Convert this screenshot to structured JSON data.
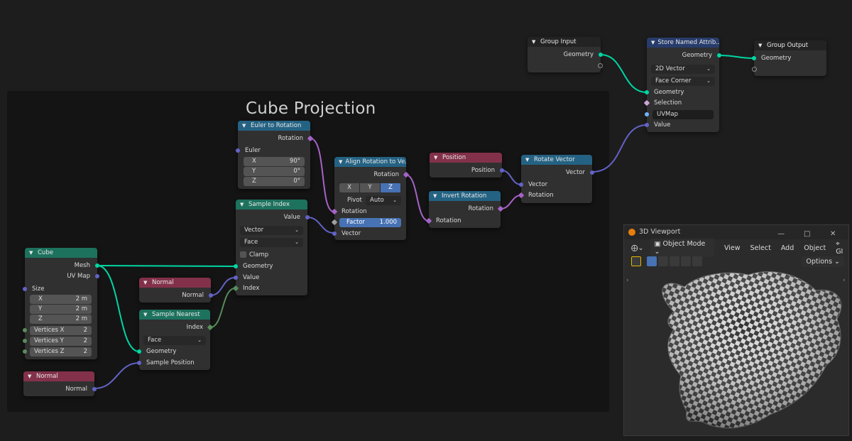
{
  "frame": {
    "title": "Cube Projection"
  },
  "nodes": {
    "group_input": {
      "title": "Group Input",
      "geometry": "Geometry"
    },
    "store_attr": {
      "title": "Store Named Attrib...",
      "geometry_out": "Geometry",
      "data_type": "2D Vector",
      "domain": "Face Corner",
      "geometry_in": "Geometry",
      "selection": "Selection",
      "name": "UVMap",
      "value": "Value"
    },
    "group_output": {
      "title": "Group Output",
      "geometry": "Geometry"
    },
    "euler": {
      "title": "Euler to Rotation",
      "rotation": "Rotation",
      "euler": "Euler",
      "x_k": "X",
      "x_v": "90°",
      "y_k": "Y",
      "y_v": "0°",
      "z_k": "Z",
      "z_v": "0°"
    },
    "align": {
      "title": "Align Rotation to Ve...",
      "rotation_out": "Rotation",
      "ax_x": "X",
      "ax_y": "Y",
      "ax_z": "Z",
      "pivot_k": "Pivot",
      "pivot_v": "Auto",
      "rotation_in": "Rotation",
      "factor_k": "Factor",
      "factor_v": "1.000",
      "vector": "Vector"
    },
    "position": {
      "title": "Position",
      "out": "Position"
    },
    "invert": {
      "title": "Invert Rotation",
      "out": "Rotation",
      "in": "Rotation"
    },
    "rotate_vec": {
      "title": "Rotate Vector",
      "out": "Vector",
      "vector": "Vector",
      "rotation": "Rotation"
    },
    "sample_index": {
      "title": "Sample Index",
      "value_out": "Value",
      "type": "Vector",
      "domain": "Face",
      "clamp": "Clamp",
      "geometry": "Geometry",
      "value_in": "Value",
      "index": "Index"
    },
    "cube": {
      "title": "Cube",
      "mesh": "Mesh",
      "uvmap": "UV Map",
      "size": "Size",
      "x_k": "X",
      "x_v": "2 m",
      "y_k": "Y",
      "y_v": "2 m",
      "z_k": "Z",
      "z_v": "2 m",
      "vx_k": "Vertices X",
      "vx_v": "2",
      "vy_k": "Vertices Y",
      "vy_v": "2",
      "vz_k": "Vertices Z",
      "vz_v": "2"
    },
    "normal1": {
      "title": "Normal",
      "out": "Normal"
    },
    "sample_nearest": {
      "title": "Sample Nearest",
      "index": "Index",
      "domain": "Face",
      "geometry": "Geometry",
      "sample_pos": "Sample Position"
    },
    "normal2": {
      "title": "Normal",
      "out": "Normal"
    }
  },
  "viewport": {
    "title": "3D Viewport",
    "mode": "Object Mode",
    "menu": [
      "View",
      "Select",
      "Add",
      "Object",
      "GI"
    ],
    "options": "Options"
  },
  "colors": {
    "geometry": "#00d6a3",
    "vector": "#6363c7",
    "rotation": "#a663c7",
    "integer": "#598c5c"
  }
}
